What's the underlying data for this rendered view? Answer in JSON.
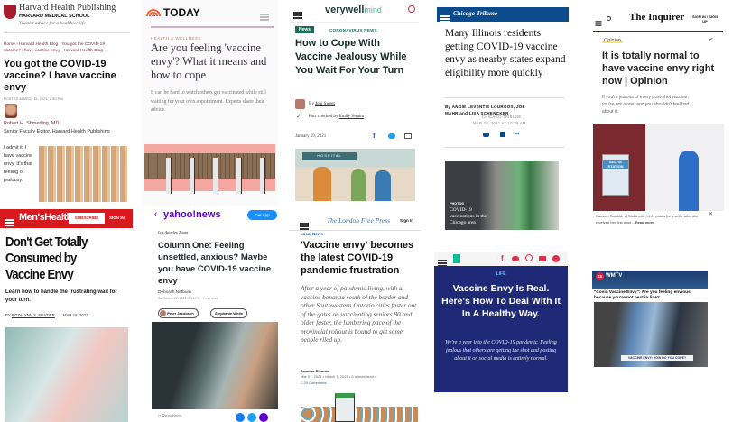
{
  "harvard": {
    "brand": "Harvard Health Publishing",
    "school": "HARVARD MEDICAL SCHOOL",
    "tagline": "Trusted advice for a healthier life",
    "breadcrumb": "Home › Harvard Health Blog › You got the COVID-19 vaccine? I have vaccine envy - Harvard Health Blog",
    "title": "You got the COVID-19 vaccine? I have vaccine envy",
    "posted": "POSTED MARCH 11, 2021, 2:30 PM",
    "author": "Robert H. Shmerling, MD",
    "role": "Senior Faculty Editor, Harvard Health Publishing",
    "body": "I admit it: I have vaccine envy. It's that feeling of jealousy."
  },
  "menshealth": {
    "brand": "Men'sHealth",
    "subscribe": "SUBSCRIBE",
    "signin": "SIGN IN",
    "title": "Don't Get Totally Consumed by Vaccine Envy",
    "dek": "Learn how to handle the frustrating wait for your turn.",
    "by": "BY",
    "author": "ROZALYNN S. FRAZIER",
    "date": "MAR 16, 2021"
  },
  "today": {
    "brand": "TODAY",
    "section": "HEALTH & WELLNESS",
    "title": "Are you feeling 'vaccine envy'? What it means and how to cope",
    "dek": "It can be hard to watch others get vaccinated while still waiting for your own appointment. Experts share their advice."
  },
  "yahoo": {
    "brand": "yahoo!news",
    "get_app": "Get App",
    "source": "Los Angeles Times",
    "title": "Column One: Feeling unsettled, anxious? Maybe you have COVID-19 vaccine envy",
    "author": "Deborah Netburn",
    "meta": "Sat, March 27, 2021, 8:21 PM · 7 min read",
    "tags": [
      "Peter Jacobsen",
      "Stephanie White"
    ],
    "reactions": "Reactions"
  },
  "verywell": {
    "brand": "verywell",
    "brand2": "mind",
    "badge": "News",
    "section": "CORONAVIRUS NEWS",
    "title": "How to Cope With Vaccine Jealousy While You Wait For Your Turn",
    "by": "By",
    "author": "Joni Sweet",
    "fact": "Fact checked by",
    "checker": "Emily Swaim",
    "date": "January 19, 2021",
    "sign": "HOSPITAL"
  },
  "lfp": {
    "brand": "The London Free Press",
    "signin": "Sign In",
    "section": "Local News",
    "title": "'Vaccine envy' becomes the latest COVID-19 pandemic frustration",
    "dek": "After a year of pandemic living, with a vaccine bonanza south of the border and other Southwestern Ontario cities faster out of the gates on vaccinating seniors 80 and older faster, the lumbering pace of the provincial rollout is bound to get some people riled up.",
    "author": "Jennifer Bieman",
    "meta": "Mar 07, 2021 • March 7, 2021 • 6 minute read •",
    "comments": "20 Comments"
  },
  "tribune": {
    "brand": "Chicago Tribune",
    "title": "Many Illinois residents getting COVID-19 vaccine envy as nearby states expand eligibility more quickly",
    "byline": "By ANGIE LEVENTIS LOURGOS, JOE MAHR and LISA SCHENCKER",
    "org": "CHICAGO TRIBUNE",
    "date": "MAR 20, 2021 AT 10:36 AM",
    "photo_label": "PHOTOS",
    "photo_caption": "COVID-19 vaccinations in the Chicago area"
  },
  "huffpost": {
    "section": "LIFE",
    "title": "Vaccine Envy Is Real. Here's How To Deal With It In A Healthy Way.",
    "dek": "We're a year into the COVID-19 pandemic. Feeling jealous that others are getting the shot and posting about it on social media is entirely normal."
  },
  "inquirer": {
    "brand": "The Inquirer",
    "signin": "SIGN IN / SIGN UP",
    "tag": "Opinion",
    "title": "It is totally normal to have vaccine envy right now | Opinion",
    "dek": "If you're jealous of every post-shot vaccine, you're not alone, and you shouldn't feel bad about it.",
    "sign": "SELFIE STATION",
    "caption": "Nazleen Randall, of Sicklerville, N.J., poses for a selfie after she received her first dose...",
    "read_more": "Read more"
  },
  "wmtv": {
    "brand": "WMTV",
    "channel": "15",
    "title": "\"Covid Vaccine Envy\": Are you feeling envious because you're not next in line?",
    "ticker": "VACCINE ENVY: HOW DO YOU COPE?"
  },
  "colors": {
    "harvard": "#a51c30",
    "menshealth": "#d71920",
    "yahoo": "#6001d2",
    "verywell": "#1b6b5a",
    "tribune": "#0b4a8b",
    "huffpost": "#1e2a78",
    "inquirer_tag": "#f7e27a"
  }
}
